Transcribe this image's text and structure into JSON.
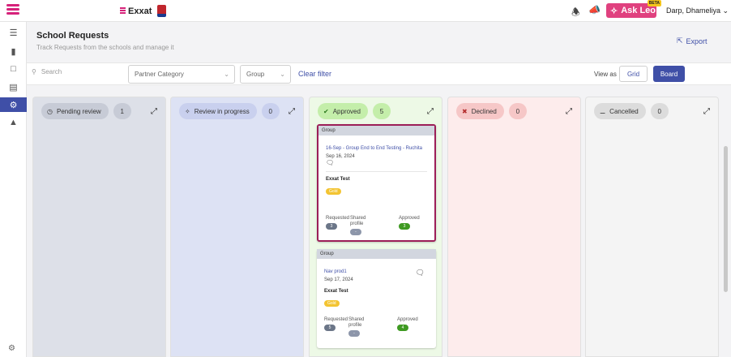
{
  "topbar": {
    "brand": "Exxat",
    "ask_leo": "Ask Leo",
    "beta": "BETA",
    "user": "Darp, Dhameliya"
  },
  "header": {
    "title": "School Requests",
    "subtitle": "Track Requests from the schools and manage it",
    "export": "Export"
  },
  "filters": {
    "search_placeholder": "Search",
    "partner_category": "Partner Category",
    "group": "Group",
    "clear": "Clear filter",
    "view_as": "View as",
    "grid": "Grid",
    "board": "Board"
  },
  "columns": [
    {
      "label": "Pending review",
      "count": "1",
      "color": "#dde0e8"
    },
    {
      "label": "Review in progress",
      "count": "0",
      "color": "#dde2f4"
    },
    {
      "label": "Approved",
      "count": "5",
      "color": "#edf9e6"
    },
    {
      "label": "Declined",
      "count": "0",
      "color": "#fdecec"
    },
    {
      "label": "Cancelled",
      "count": "0",
      "color": "#f4f4f4"
    }
  ],
  "cards": [
    {
      "group": "Group",
      "title": "16-Sep - Group End to End Testing - Ruchita",
      "date": "Sep 16, 2024",
      "org": "Exxat Test",
      "tier": "Gold",
      "requested_label": "Requested",
      "requested": "3",
      "shared_label": "Shared profile",
      "shared": "-",
      "approved_label": "Approved",
      "approved": "3"
    },
    {
      "group": "Group",
      "title": "Nav prod1",
      "date": "Sep 17, 2024",
      "org": "Exxat Test",
      "tier": "Gold",
      "requested_label": "Requested",
      "requested": "5",
      "shared_label": "Shared profile",
      "shared": "-",
      "approved_label": "Approved",
      "approved": "4"
    }
  ]
}
